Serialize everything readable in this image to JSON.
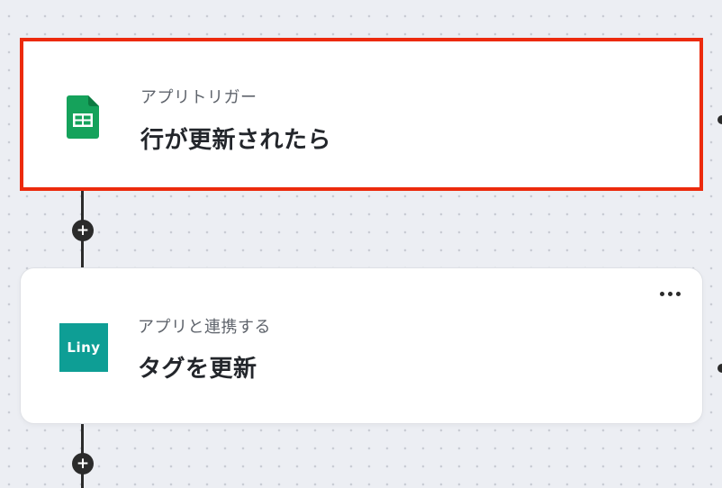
{
  "trigger_card": {
    "category": "アプリトリガー",
    "title": "行が更新されたら",
    "icon": "google-sheets-icon"
  },
  "action_card": {
    "category": "アプリと連携する",
    "title": "タグを更新",
    "icon": "liny-icon",
    "icon_label": "Liny"
  },
  "add_step_symbol": "+",
  "colors": {
    "selection_border": "#ec2a0d",
    "sheets_green": "#15a25b",
    "liny_teal": "#0e9e95",
    "connector": "#2b2b2b"
  }
}
